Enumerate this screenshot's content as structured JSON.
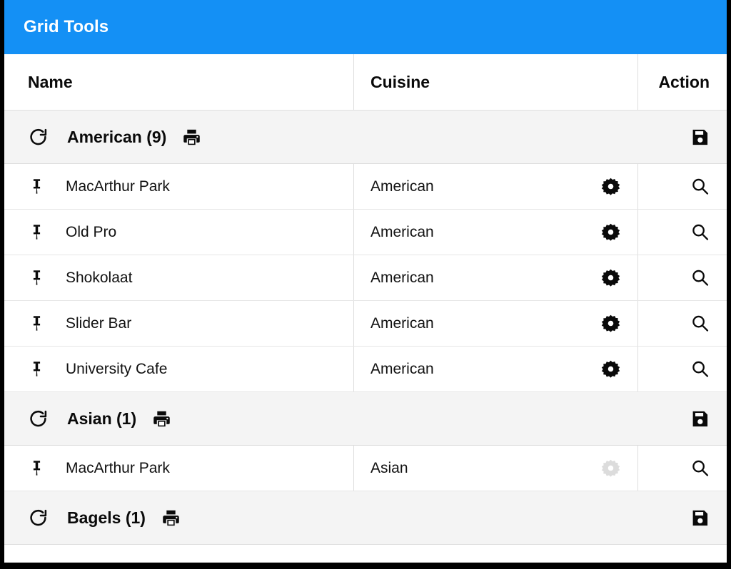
{
  "window": {
    "title": "Grid Tools",
    "accent_color": "#1490f5",
    "group_header_bg": "#f4f4f4",
    "disabled_icon_color": "#dcdcdc"
  },
  "grid": {
    "columns": [
      {
        "key": "name",
        "label": "Name",
        "align": "left"
      },
      {
        "key": "cuisine",
        "label": "Cuisine",
        "align": "left"
      },
      {
        "key": "action",
        "label": "Action",
        "align": "right"
      }
    ],
    "groups": [
      {
        "label": "American (9)",
        "refresh_icon": "refresh-icon",
        "print_icon": "print-icon",
        "save_icon": "save-icon",
        "rows": [
          {
            "pin_icon": "pin-icon",
            "name": "MacArthur Park",
            "cuisine": "American",
            "gear_icon": "gear-icon",
            "gear_disabled": false,
            "search_icon": "search-icon"
          },
          {
            "pin_icon": "pin-icon",
            "name": "Old Pro",
            "cuisine": "American",
            "gear_icon": "gear-icon",
            "gear_disabled": false,
            "search_icon": "search-icon"
          },
          {
            "pin_icon": "pin-icon",
            "name": "Shokolaat",
            "cuisine": "American",
            "gear_icon": "gear-icon",
            "gear_disabled": false,
            "search_icon": "search-icon"
          },
          {
            "pin_icon": "pin-icon",
            "name": "Slider Bar",
            "cuisine": "American",
            "gear_icon": "gear-icon",
            "gear_disabled": false,
            "search_icon": "search-icon"
          },
          {
            "pin_icon": "pin-icon",
            "name": "University Cafe",
            "cuisine": "American",
            "gear_icon": "gear-icon",
            "gear_disabled": false,
            "search_icon": "search-icon"
          }
        ]
      },
      {
        "label": "Asian (1)",
        "refresh_icon": "refresh-icon",
        "print_icon": "print-icon",
        "save_icon": "save-icon",
        "rows": [
          {
            "pin_icon": "pin-icon",
            "name": "MacArthur Park",
            "cuisine": "Asian",
            "gear_icon": "gear-icon",
            "gear_disabled": true,
            "search_icon": "search-icon"
          }
        ]
      },
      {
        "label": "Bagels (1)",
        "refresh_icon": "refresh-icon",
        "print_icon": "print-icon",
        "save_icon": "save-icon",
        "rows": []
      }
    ]
  }
}
